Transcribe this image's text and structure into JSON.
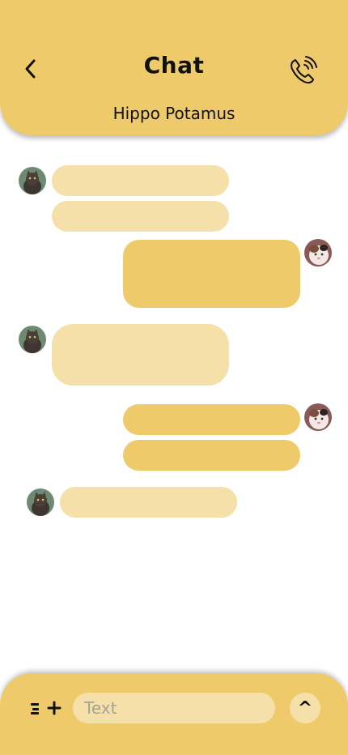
{
  "header": {
    "title": "Chat",
    "contact_name": "Hippo Potamus",
    "back_icon": "chevron-left-icon",
    "call_icon": "phone-call-icon"
  },
  "messages": [
    {
      "sender": "contact",
      "text": ""
    },
    {
      "sender": "contact",
      "text": ""
    },
    {
      "sender": "me",
      "text": ""
    },
    {
      "sender": "contact",
      "text": ""
    },
    {
      "sender": "me",
      "text": ""
    },
    {
      "sender": "me",
      "text": ""
    },
    {
      "sender": "contact",
      "text": ""
    }
  ],
  "composer": {
    "placeholder": "Text",
    "menu_icon": "menu-icon",
    "add_icon": "plus-icon",
    "send_label": "^"
  },
  "colors": {
    "accent": "#EFCA6B",
    "incoming_bubble": "#F5E0A9",
    "outgoing_bubble": "#EFCA6B",
    "background": "#FFFFFF"
  }
}
